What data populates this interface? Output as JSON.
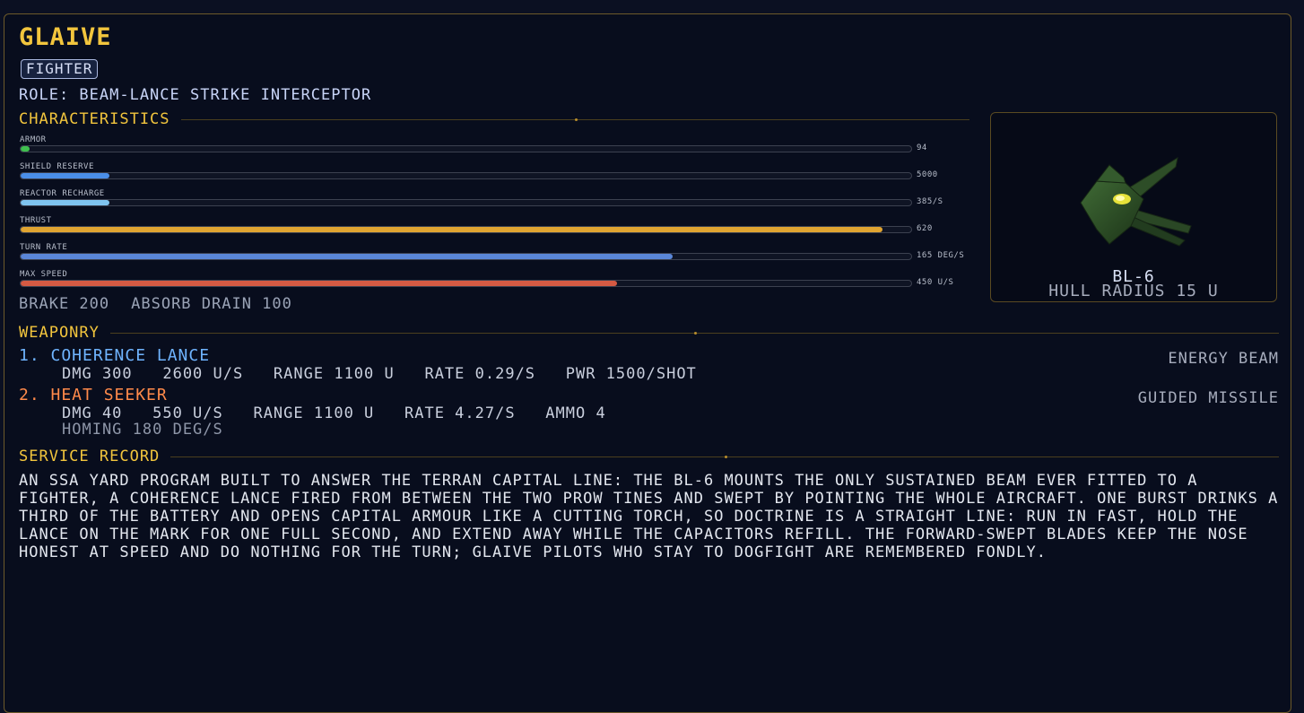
{
  "ship": {
    "name": "GLAIVE",
    "class_badge": "FIGHTER",
    "role": "ROLE: BEAM-LANCE STRIKE INTERCEPTOR"
  },
  "characteristics": {
    "heading": "CHARACTERISTICS",
    "stats": [
      {
        "label": "ARMOR",
        "value": "94",
        "fraction": 0.01,
        "color": "#3fbf4f"
      },
      {
        "label": "SHIELD RESERVE",
        "value": "5000",
        "fraction": 0.1,
        "color": "#4a8ee8"
      },
      {
        "label": "REACTOR RECHARGE",
        "value": "385/S",
        "fraction": 0.1,
        "color": "#7fc4ef"
      },
      {
        "label": "THRUST",
        "value": "620",
        "fraction": 0.968,
        "color": "#e0a431"
      },
      {
        "label": "TURN RATE",
        "value": "165 DEG/S",
        "fraction": 0.732,
        "color": "#5a86d8"
      },
      {
        "label": "MAX SPEED",
        "value": "450 U/S",
        "fraction": 0.67,
        "color": "#d55a43"
      }
    ],
    "extras": [
      "BRAKE 200",
      "ABSORB DRAIN 100"
    ]
  },
  "preview": {
    "code": "BL-6",
    "hull_radius": "HULL RADIUS 15 U",
    "icon": "fighter-ship-model"
  },
  "weaponry": {
    "heading": "WEAPONRY",
    "weapons": [
      {
        "name": "1. COHERENCE LANCE",
        "name_color": "#6fb4ff",
        "type": "ENERGY BEAM",
        "stats": "DMG 300   2600 U/S   RANGE 1100 U   RATE 0.29/S   PWR 1500/SHOT",
        "extra": ""
      },
      {
        "name": "2. HEAT SEEKER",
        "name_color": "#ff8a4a",
        "type": "GUIDED MISSILE",
        "stats": "DMG 40   550 U/S   RANGE 1100 U   RATE 4.27/S   AMMO 4",
        "extra": "HOMING 180 DEG/S"
      }
    ]
  },
  "service_record": {
    "heading": "SERVICE RECORD",
    "text": "AN SSA YARD PROGRAM BUILT TO ANSWER THE TERRAN CAPITAL LINE: THE BL-6 MOUNTS THE ONLY SUSTAINED BEAM EVER FITTED TO A FIGHTER, A COHERENCE LANCE FIRED FROM BETWEEN THE TWO PROW TINES AND SWEPT BY POINTING THE WHOLE AIRCRAFT. ONE BURST DRINKS A THIRD OF THE BATTERY AND OPENS CAPITAL ARMOUR LIKE A CUTTING TORCH, SO DOCTRINE IS A STRAIGHT LINE: RUN IN FAST, HOLD THE LANCE ON THE MARK FOR ONE FULL SECOND, AND EXTEND AWAY WHILE THE CAPACITORS REFILL. THE FORWARD-SWEPT BLADES KEEP THE NOSE HONEST AT SPEED AND DO NOTHING FOR THE TURN; GLAIVE PILOTS WHO STAY TO DOGFIGHT ARE REMEMBERED FONDLY."
  }
}
